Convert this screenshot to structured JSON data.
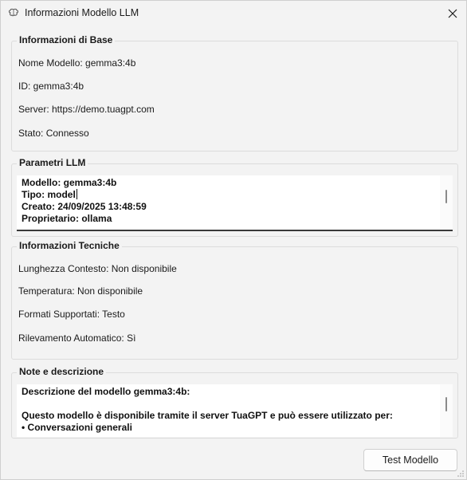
{
  "window": {
    "title": "Informazioni Modello LLM",
    "icon": "brain-icon",
    "close_icon": "close-icon"
  },
  "base_info": {
    "title": "Informazioni di Base",
    "rows": [
      "Nome Modello: gemma3:4b",
      "ID: gemma3:4b",
      "Server: https://demo.tuagpt.com",
      "Stato: Connesso"
    ]
  },
  "llm_params": {
    "title": "Parametri LLM",
    "lines": [
      "Modello: gemma3:4b",
      "Tipo: model",
      "Creato: 24/09/2025 13:48:59",
      "Proprietario: ollama"
    ]
  },
  "tech_info": {
    "title": "Informazioni Tecniche",
    "rows": [
      "Lunghezza Contesto: Non disponibile",
      "Temperatura: Non disponibile",
      "Formati Supportati: Testo",
      "Rilevamento Automatico: Sì"
    ]
  },
  "notes": {
    "title": "Note e descrizione",
    "lines": [
      "Descrizione del modello gemma3:4b:",
      "",
      "Questo modello è disponibile tramite il server TuaGPT e può essere utilizzato per:",
      "• Conversazioni generali"
    ]
  },
  "actions": {
    "test_label": "Test Modello"
  }
}
